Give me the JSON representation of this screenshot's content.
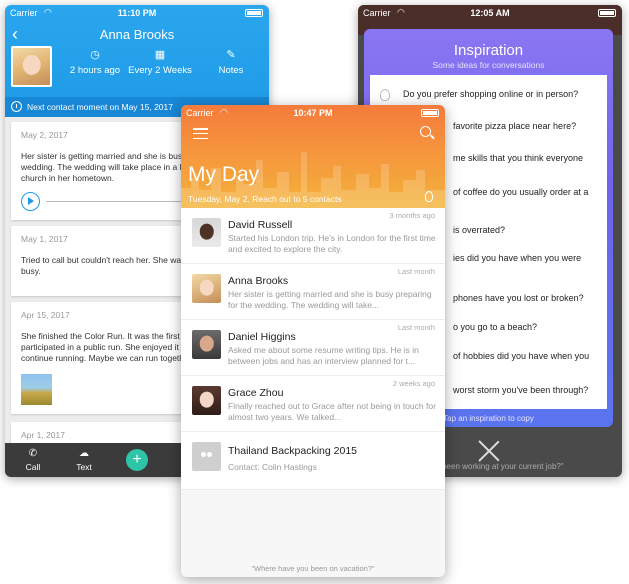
{
  "left": {
    "status": {
      "carrier": "Carrier",
      "time": "11:10 PM"
    },
    "contact_name": "Anna Brooks",
    "stats": [
      {
        "icon": "clock-icon",
        "label": "2 hours ago"
      },
      {
        "icon": "calendar-icon",
        "label": "Every 2 Weeks"
      },
      {
        "icon": "notes-icon",
        "label": "Notes"
      }
    ],
    "next_contact": "Next contact moment on May 15, 2017",
    "entries": [
      {
        "date": "May 2, 2017",
        "text": "Her sister is getting married and she is busy preparing for the wedding. The wedding will take place in a beautiful small church in her hometown."
      },
      {
        "date": "May 1, 2017",
        "text": "Tried to call but couldn't reach her. She was keeping her busy."
      },
      {
        "date": "Apr 15, 2017",
        "text": "She finished the Color Run. It was the first time she participated in a public run. She enjoyed it and wants to continue running. Maybe we can run together?"
      },
      {
        "date": "Apr 1, 2017"
      }
    ],
    "tabbar": {
      "call": "Call",
      "text": "Text"
    }
  },
  "center": {
    "status": {
      "carrier": "Carrier",
      "time": "10:47 PM"
    },
    "title": "My Day",
    "subtitle": "Tuesday, May 2. Reach out to 5 contacts",
    "contacts": [
      {
        "name": "David Russell",
        "time": "3 months ago",
        "preview": "Started his London trip. He's in London for the first time and excited to explore the city."
      },
      {
        "name": "Anna Brooks",
        "time": "Last month",
        "preview": "Her sister is getting married and she is busy preparing for the wedding. The wedding will take..."
      },
      {
        "name": "Daniel Higgins",
        "time": "Last month",
        "preview": "Asked me about some resume writing tips. He is in between jobs and has an interview planned for t..."
      },
      {
        "name": "Grace Zhou",
        "time": "2 weeks ago",
        "preview": "Finally reached out to Grace after not being in touch for almost two years. We talked..."
      },
      {
        "name": "Thailand Backpacking 2015",
        "time": "",
        "preview": "Contact: Colin Hastings"
      }
    ],
    "footer_question": "\"Where have you been on vacation?\""
  },
  "right": {
    "status": {
      "carrier": "Carrier",
      "time": "12:05 AM"
    },
    "title": "Inspiration",
    "subtitle": "Some ideas for conversations",
    "questions": [
      "Do you prefer shopping online or in person?",
      "favorite pizza place near here?",
      "me skills that you think everyone",
      "of coffee do you usually order at a",
      "is overrated?",
      "ies did you have when you were",
      "phones have you lost or broken?",
      "o you go to a beach?",
      "of hobbies did you have when you",
      "worst storm you've been through?"
    ],
    "hint": "Tap an inspiration to copy",
    "bottom_question": "ve you been working at your current job?\""
  }
}
